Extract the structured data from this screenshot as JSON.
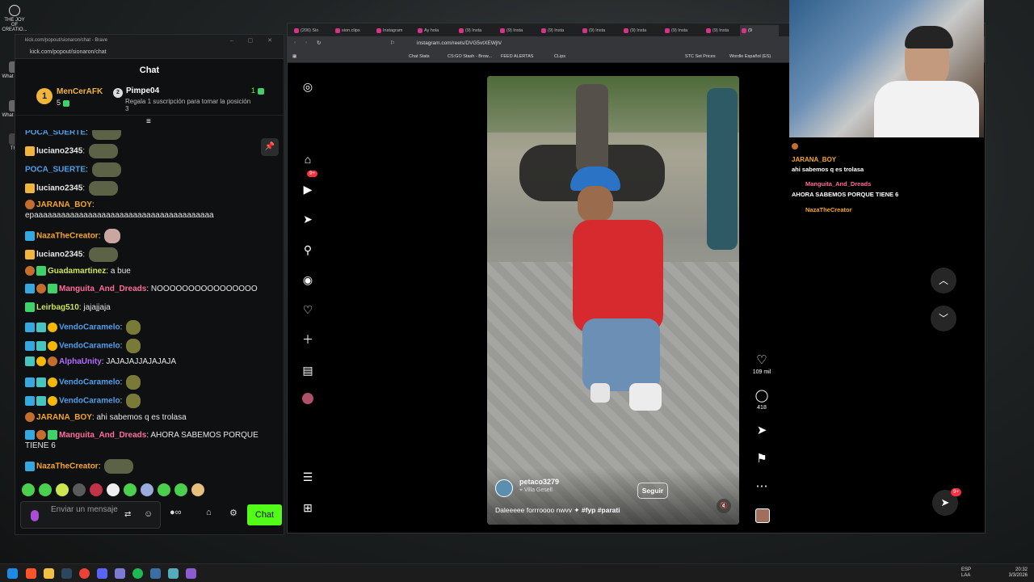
{
  "desktop": {
    "icons": [
      {
        "label": "THE JOY OF CREATIO..."
      },
      {
        "label": "What Video"
      },
      {
        "label": "What Video"
      },
      {
        "label": "The"
      }
    ]
  },
  "chat_window": {
    "title": "kick.com/popout/sionaron/chat - Brave",
    "url": "kick.com/popout/sionaron/chat",
    "header": "Chat",
    "leaderboard": [
      {
        "rank": "1",
        "name": "MenCerAFK",
        "count": "5",
        "color": "#f0b53a"
      },
      {
        "rank": "2",
        "name": "Pimpe04",
        "count": "1",
        "note": "Regala 1 suscripción para tomar la posición 3",
        "color": "#e6e6e6"
      }
    ],
    "messages": [
      {
        "user": "POCA_SUERTE",
        "color": "#4e9fea",
        "text": ""
      },
      {
        "user": "luciano2345",
        "color": "#e8e8e8",
        "text": ""
      },
      {
        "user": "POCA_SUERTE",
        "color": "#4e9fea",
        "text": ""
      },
      {
        "user": "luciano2345",
        "color": "#e8e8e8",
        "text": ""
      },
      {
        "user": "JARANA_BOY",
        "color": "#f5a623",
        "text": "epaaaaaaaaaaaaaaaaaaaaaaaaaaaaaaaaaaaaaaaa"
      },
      {
        "user": "NazaTheCreator",
        "color": "#f5a623",
        "text": ""
      },
      {
        "user": "luciano2345",
        "color": "#e8e8e8",
        "text": ""
      },
      {
        "user": "Guadamartinez",
        "color": "#cde64f",
        "text": "a bue"
      },
      {
        "user": "Manguita_And_Dreads",
        "color": "#ff6b9a",
        "text": "NOOOOOOOOOOOOOOOO"
      },
      {
        "user": "Leirbag510",
        "color": "#cde64f",
        "text": "jajajjaja"
      },
      {
        "user": "VendoCaramelo",
        "color": "#4e9fea",
        "text": ""
      },
      {
        "user": "VendoCaramelo",
        "color": "#4e9fea",
        "text": ""
      },
      {
        "user": "AlphaUnity",
        "color": "#b46bff",
        "text": "JAJAJAJJAJAJAJA"
      },
      {
        "user": "VendoCaramelo",
        "color": "#4e9fea",
        "text": ""
      },
      {
        "user": "VendoCaramelo",
        "color": "#4e9fea",
        "text": ""
      },
      {
        "user": "JARANA_BOY",
        "color": "#f5a623",
        "text": "ahi sabemos q es trolasa"
      },
      {
        "user": "Manguita_And_Dreads",
        "color": "#ff6b9a",
        "text": "AHORA SABEMOS PORQUE TIENE 6"
      },
      {
        "user": "NazaTheCreator",
        "color": "#f5a623",
        "text": ""
      }
    ],
    "input_placeholder": "Enviar un mensaje",
    "send_label": "Chat"
  },
  "browser": {
    "tabs": [
      {
        "label": "(206) Sio"
      },
      {
        "label": "sion.clips"
      },
      {
        "label": "Instagram"
      },
      {
        "label": "Ay hola"
      },
      {
        "label": "(9) Insta"
      },
      {
        "label": "(9) Insta"
      },
      {
        "label": "(9) Insta"
      },
      {
        "label": "(9) Insta"
      },
      {
        "label": "(9) Insta"
      },
      {
        "label": "(9) Insta"
      },
      {
        "label": "(9) Insta"
      },
      {
        "label": "(9"
      }
    ],
    "url": "instagram.com/reels/DVG5vtXEWjh/",
    "bookmarks": [
      "Chat Stats",
      "CS:GO Stash - Brow...",
      "FEED ALERTAS",
      "CLips",
      "STC Set Prices",
      "Wordle Español (ES)"
    ]
  },
  "instagram": {
    "notification_badge": "9+",
    "post": {
      "author": "petaco3279",
      "location": "Villa Gesell",
      "follow_label": "Seguir",
      "caption_text": "Daleeeee forrroooo nwvv",
      "caption_tags": "#fyp #parati"
    },
    "actions": {
      "likes": "109 mil",
      "comments": "418"
    },
    "message_badge": "9+"
  },
  "stream_chat": [
    {
      "user": "",
      "text": ""
    },
    {
      "user": "JARANA_BOY",
      "text": "ahi sabemos q es trolasa",
      "color": "#f5a623"
    },
    {
      "user": "Manguita_And_Dreads",
      "text": "AHORA SABEMOS PORQUE TIENE 6",
      "color": "#ff6b9a"
    },
    {
      "user": "NazaTheCreator",
      "text": "",
      "color": "#f5a623"
    }
  ],
  "taskbar": {
    "lang_top": "ESP",
    "lang_bottom": "LAA",
    "time": "20:32",
    "date": "3/3/2026"
  },
  "colors": {
    "kick_green": "#53fc18",
    "ig_badge": "#ff3040"
  }
}
